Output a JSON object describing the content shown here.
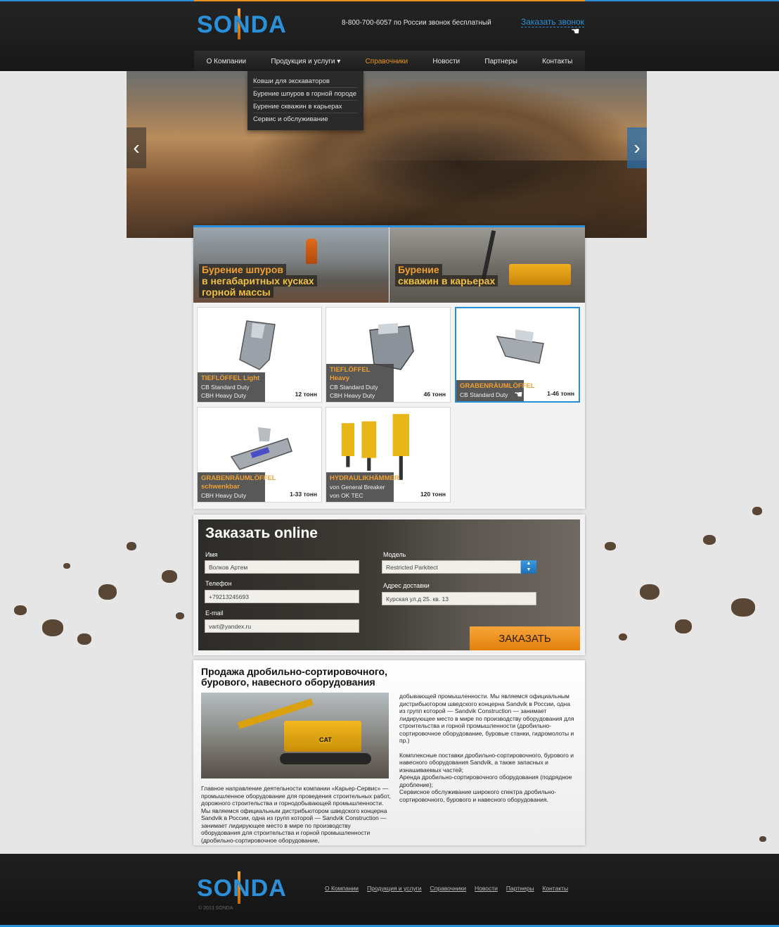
{
  "header": {
    "logo": "SONDA",
    "phone": "8-800-700-6057 по России звонок бесплатный",
    "callback": "Заказать звонок"
  },
  "nav": {
    "items": [
      {
        "label": "О Компании"
      },
      {
        "label": "Продукция и услуги ▾"
      },
      {
        "label": "Справочники"
      },
      {
        "label": "Новости"
      },
      {
        "label": "Партнеры"
      },
      {
        "label": "Контакты"
      }
    ],
    "active": "Справочники",
    "dropdown": [
      "Ковши для экскаваторов",
      "Бурение шпуров в горной породе",
      "Бурение скважин в карьерах",
      "Сервис и обслуживание"
    ]
  },
  "promos": [
    {
      "line1": "Бурение шпуров",
      "line2": "в негабаритных кусках",
      "line3": "горной массы"
    },
    {
      "line1": "Бурение",
      "line2": "скважин в карьерах"
    }
  ],
  "products": [
    {
      "name": "TIEFLÖFFEL Light",
      "sub1": "CB Standard Duty",
      "sub2": "CBH Heavy Duty",
      "weight": "12 тонн"
    },
    {
      "name": "TIEFLÖFFEL Heavy",
      "sub1": "CB Standard Duty",
      "sub2": "CBH Heavy Duty",
      "weight": "46 тонн"
    },
    {
      "name": "GRABENRÄUMLÖFFEL",
      "sub1": "CB Standard Duty",
      "sub2": "",
      "weight": "1-46 тонн"
    },
    {
      "name": "GRABENRÄUMLÖFFEL schwenkbar",
      "sub1": "CBH Heavy Duty",
      "sub2": "",
      "weight": "1-33 тонн"
    },
    {
      "name": "HYDRAULIKHÄMMER",
      "sub1": "von General Breaker",
      "sub2": "von OK TEC",
      "weight": "120 тонн"
    }
  ],
  "order": {
    "title": "Заказать online",
    "name_label": "Имя",
    "name_value": "Волков Артем",
    "phone_label": "Телефон",
    "phone_value": "+79213245693",
    "email_label": "E-mail",
    "email_value": "vart@yandex.ru",
    "model_label": "Модель",
    "model_value": "Restricted Parkitect",
    "address_label": "Адрес доставки",
    "address_value": "Курская ул.д 25. кв. 13",
    "submit": "ЗАКАЗАТЬ"
  },
  "article": {
    "title": "Продажа дробильно-сортировочного, бурового, навесного оборудования",
    "image_label": "CAT",
    "left_text": "Главное направление деятельности компании «Карьер-Сервис» — промышленное оборудование для проведения строительных работ, дорожного строительства и горнодобывающей промышленности. Мы являемся официальным дистрибьютором шведского концерна Sandvik в России, одна из групп которой — Sandvik Construction — занимает лидирующее место в мире по производству оборудования для строительства и горной промышленности (дробильно-сортировочное оборудование,",
    "right_text_1": "добывающей промышленности. Мы являемся официальным дистрибьютором шведского концерна Sandvik в России, одна из групп которой — Sandvik Construction — занимает лидирующее место в мире по производству оборудования для строительства и горной промышленности (дробильно-сортировочное оборудование, буровые станки, гидромолоты и пр.)",
    "right_text_2": "Комплексные поставки дробильно-сортировочного, бурового и навесного оборудования Sandvik, а также запасных и изнашиваемых частей;",
    "right_text_3": "Аренда дробильно-сортировочного оборудования (подрядное дробление);",
    "right_text_4": "Сервисное обслуживание широкого спектра дробильно-сортировочного, бурового и навесного оборудования."
  },
  "footer": {
    "logo": "SONDA",
    "copyright": "© 2013 SONDA",
    "links": [
      "О Компании",
      "Продукция и услуги",
      "Справочники",
      "Новости",
      "Партнеры",
      "Контакты"
    ]
  },
  "icons": {
    "slider_left": "chevron-left-icon",
    "slider_right": "chevron-right-icon",
    "select": "select-arrows-icon",
    "cursor": "hand-cursor-icon"
  },
  "colors": {
    "accent_blue": "#2a8fd8",
    "accent_orange": "#e8911c",
    "header_bg": "#1c1c1c"
  }
}
